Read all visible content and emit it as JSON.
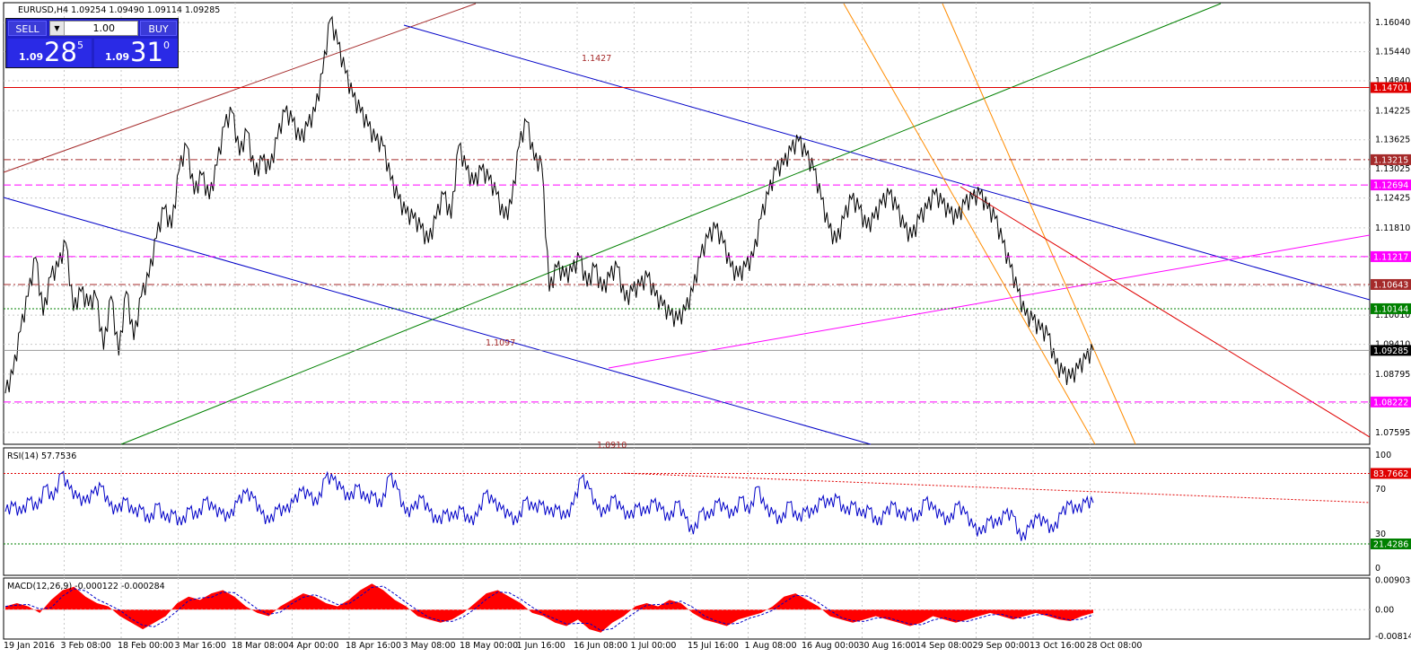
{
  "symbol_header": "EURUSD,H4  1.09254 1.09490 1.09114 1.09285",
  "trade_panel": {
    "sell_label": "SELL",
    "buy_label": "BUY",
    "lot": "1.00",
    "sell_prefix": "1.09",
    "sell_big": "28",
    "sell_sup": "5",
    "buy_prefix": "1.09",
    "buy_big": "31",
    "buy_sup": "0",
    "arrow_icon": "dropdown-arrow-icon"
  },
  "colors": {
    "background": "#ffffff",
    "price_line": "#000000",
    "channel_blue": "#0000c8",
    "trend_green": "#008000",
    "trend_brown": "#a52a2a",
    "trend_orange": "#ff8c00",
    "trend_red": "#e00000",
    "magenta": "#ff00ff",
    "rsi_line": "#0000c8",
    "macd_hist": "#ff0000"
  },
  "chart_data": [
    {
      "type": "line",
      "panel": "price",
      "x": [
        "19 Jan 2016",
        "3 Feb 08:00",
        "18 Feb 00:00",
        "3 Mar 16:00",
        "18 Mar 08:00",
        "4 Apr 00:00",
        "18 Apr 16:00",
        "3 May 08:00",
        "18 May 00:00",
        "1 Jun 16:00",
        "16 Jun 08:00",
        "1 Jul 00:00",
        "15 Jul 16:00",
        "1 Aug 08:00",
        "16 Aug 00:00",
        "30 Aug 16:00",
        "14 Sep 08:00",
        "29 Sep 00:00",
        "13 Oct 16:00",
        "28 Oct 08:00"
      ],
      "y_ticks": [
        "1.16040",
        "1.15440",
        "1.14840",
        "1.14225",
        "1.13625",
        "1.13025",
        "1.12425",
        "1.11810",
        "1.11210",
        "1.10610",
        "1.10010",
        "1.09410",
        "1.08795",
        "1.08195",
        "1.07595"
      ],
      "ylim": [
        1.0735,
        1.1645
      ],
      "close": [
        1.084,
        1.088,
        1.0968,
        1.104,
        1.112,
        1.1,
        1.108,
        1.11,
        1.115,
        1.101,
        1.105,
        1.102,
        1.104,
        1.093,
        1.104,
        1.0918,
        1.105,
        1.095,
        1.104,
        1.108,
        1.116,
        1.122,
        1.118,
        1.13,
        1.135,
        1.125,
        1.129,
        1.124,
        1.131,
        1.139,
        1.142,
        1.133,
        1.138,
        1.129,
        1.132,
        1.13,
        1.1365,
        1.142,
        1.14,
        1.136,
        1.139,
        1.142,
        1.15,
        1.161,
        1.156,
        1.15,
        1.145,
        1.142,
        1.139,
        1.136,
        1.135,
        1.128,
        1.124,
        1.121,
        1.12,
        1.118,
        1.115,
        1.12,
        1.125,
        1.12,
        1.135,
        1.13,
        1.127,
        1.13,
        1.128,
        1.125,
        1.12,
        1.123,
        1.135,
        1.14,
        1.132,
        1.131,
        1.105,
        1.11,
        1.108,
        1.109,
        1.112,
        1.106,
        1.11,
        1.105,
        1.108,
        1.11,
        1.103,
        1.105,
        1.106,
        1.108,
        1.104,
        1.102,
        1.1,
        1.099,
        1.101,
        1.105,
        1.112,
        1.116,
        1.118,
        1.115,
        1.11,
        1.108,
        1.11,
        1.112,
        1.12,
        1.125,
        1.13,
        1.131,
        1.134,
        1.136,
        1.133,
        1.13,
        1.124,
        1.118,
        1.115,
        1.12,
        1.124,
        1.122,
        1.118,
        1.12,
        1.123,
        1.125,
        1.122,
        1.118,
        1.116,
        1.12,
        1.122,
        1.125,
        1.123,
        1.121,
        1.12,
        1.123,
        1.124,
        1.125,
        1.122,
        1.12,
        1.115,
        1.11,
        1.105,
        1.1,
        1.099,
        1.097,
        1.096,
        1.09,
        1.088,
        1.087,
        1.089,
        1.091,
        1.0928
      ],
      "annotations": [
        "1.1427",
        "1.1097",
        "1.0910"
      ],
      "levels": [
        {
          "label": "1.14701",
          "value": 1.14701,
          "color": "#e00000",
          "style": "solid"
        },
        {
          "label": "1.13215",
          "value": 1.13215,
          "color": "#a52a2a",
          "style": "dashdot"
        },
        {
          "label": "1.12694",
          "value": 1.12694,
          "color": "#ff00ff",
          "style": "dashed"
        },
        {
          "label": "1.11217",
          "value": 1.11217,
          "color": "#ff00ff",
          "style": "dashed"
        },
        {
          "label": "1.10643",
          "value": 1.10643,
          "color": "#a52a2a",
          "style": "dashdot"
        },
        {
          "label": "1.10144",
          "value": 1.10144,
          "color": "#008000",
          "style": "dotted"
        },
        {
          "label": "1.09285",
          "value": 1.09285,
          "color": "#999999",
          "style": "solid"
        },
        {
          "label": "1.08222",
          "value": 1.08222,
          "color": "#ff00ff",
          "style": "dashed"
        }
      ],
      "grid": true
    },
    {
      "type": "line",
      "panel": "rsi",
      "title": "RSI(14) 57.7536",
      "y_ticks": [
        "100",
        "70",
        "30",
        "0"
      ],
      "ylim": [
        0,
        100
      ],
      "levels": [
        {
          "label": "83.7662",
          "value": 83.7662,
          "color": "#e00000"
        },
        {
          "label": "21.4286",
          "value": 21.4286,
          "color": "#008000"
        }
      ],
      "values": [
        50,
        55,
        48,
        60,
        52,
        72,
        60,
        84,
        70,
        62,
        58,
        66,
        72,
        55,
        50,
        60,
        48,
        52,
        40,
        56,
        42,
        48,
        38,
        52,
        44,
        60,
        52,
        48,
        44,
        58,
        66,
        62,
        48,
        40,
        52,
        50,
        58,
        68,
        64,
        56,
        80,
        78,
        70,
        60,
        72,
        60,
        64,
        54,
        82,
        70,
        48,
        52,
        62,
        50,
        40,
        48,
        44,
        52,
        40,
        46,
        66,
        58,
        52,
        46,
        40,
        60,
        52,
        56,
        48,
        52,
        44,
        56,
        80,
        70,
        52,
        48,
        62,
        52,
        44,
        54,
        48,
        58,
        52,
        42,
        58,
        44,
        30,
        50,
        44,
        58,
        52,
        46,
        62,
        48,
        72,
        52,
        48,
        40,
        58,
        42,
        50,
        48,
        60,
        56,
        62,
        48,
        56,
        46,
        52,
        38,
        48,
        56,
        44,
        50,
        42,
        60,
        52,
        46,
        40,
        56,
        48,
        36,
        30,
        42,
        38,
        48,
        46,
        24,
        36,
        44,
        40,
        32,
        48,
        56,
        50,
        58,
        57.75
      ]
    },
    {
      "type": "bar",
      "panel": "macd",
      "title": "MACD(12,26,9) -0.000122 -0.000284",
      "y_ticks": [
        "0.009031",
        "0.00",
        "-0.008146"
      ],
      "ylim": [
        -0.009,
        0.0097
      ],
      "hist": [
        0.001,
        0.002,
        0.001,
        -0.001,
        0.003,
        0.006,
        0.007,
        0.004,
        0.002,
        0.001,
        -0.002,
        -0.004,
        -0.006,
        -0.004,
        -0.002,
        0.002,
        0.004,
        0.003,
        0.005,
        0.006,
        0.004,
        0.001,
        -0.001,
        -0.002,
        0.001,
        0.003,
        0.005,
        0.004,
        0.002,
        0.001,
        0.003,
        0.006,
        0.008,
        0.006,
        0.003,
        0.001,
        -0.002,
        -0.003,
        -0.004,
        -0.003,
        -0.001,
        0.002,
        0.005,
        0.006,
        0.004,
        0.002,
        -0.001,
        -0.002,
        -0.004,
        -0.005,
        -0.003,
        -0.006,
        -0.007,
        -0.004,
        -0.002,
        0.001,
        0.002,
        0.001,
        0.003,
        0.002,
        -0.001,
        -0.003,
        -0.004,
        -0.005,
        -0.003,
        -0.002,
        -0.001,
        0.001,
        0.004,
        0.005,
        0.003,
        0.001,
        -0.002,
        -0.003,
        -0.004,
        -0.003,
        -0.002,
        -0.003,
        -0.004,
        -0.005,
        -0.004,
        -0.002,
        -0.003,
        -0.004,
        -0.003,
        -0.002,
        -0.001,
        -0.002,
        -0.003,
        -0.002,
        -0.001,
        -0.002,
        -0.003,
        -0.0035,
        -0.002,
        -0.001
      ]
    }
  ],
  "time_axis_labels": [
    "19 Jan 2016",
    "3 Feb 08:00",
    "18 Feb 00:00",
    "3 Mar 16:00",
    "18 Mar 08:00",
    "4 Apr 00:00",
    "18 Apr 16:00",
    "3 May 08:00",
    "18 May 00:00",
    "1 Jun 16:00",
    "16 Jun 08:00",
    "1 Jul 00:00",
    "15 Jul 16:00",
    "1 Aug 08:00",
    "16 Aug 00:00",
    "30 Aug 16:00",
    "14 Sep 08:00",
    "29 Sep 00:00",
    "13 Oct 16:00",
    "28 Oct 08:00"
  ]
}
